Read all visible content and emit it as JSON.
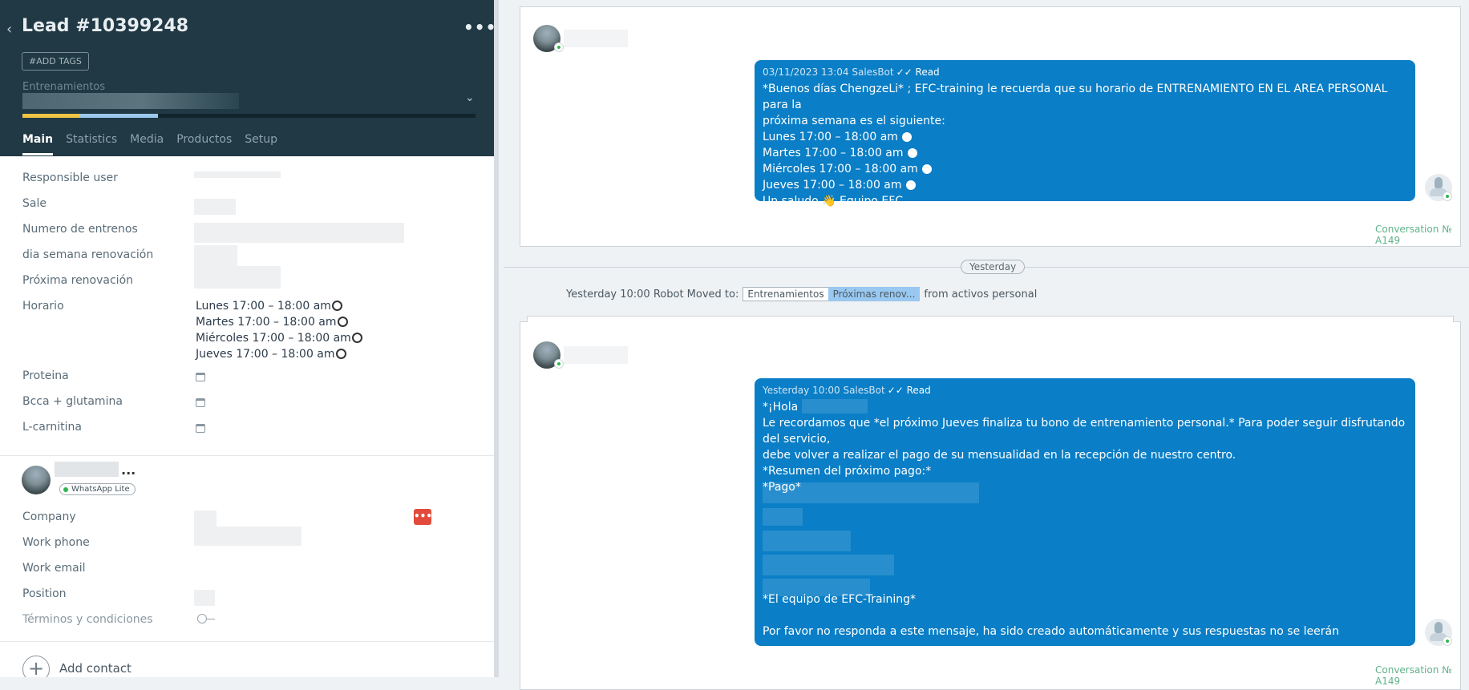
{
  "lead": {
    "title": "Lead #10399248",
    "more": "•••",
    "back": "‹",
    "add_tags": "#ADD TAGS",
    "pipeline_label": "Entrenamientos",
    "tabs": [
      "Main",
      "Statistics",
      "Media",
      "Productos",
      "Setup"
    ]
  },
  "fields": {
    "responsible_user": "Responsible user",
    "sale": "Sale",
    "numero_entrenos": "Numero de entrenos",
    "dia_semana": "dia semana renovación",
    "proxima_renovacion": "Próxima renovación",
    "horario": "Horario",
    "horario_lines": [
      "Lunes 17:00 – 18:00 am",
      "Martes 17:00 – 18:00 am",
      "Miércoles 17:00 – 18:00 am",
      "Jueves 17:00 – 18:00 am"
    ],
    "proteina": "Proteina",
    "bcca": "Bcca + glutamina",
    "lcarnitina": "L-carnitina"
  },
  "contact": {
    "more": "...",
    "badge": "WhatsApp Lite",
    "company": "Company",
    "company_btn": "•••",
    "work_phone": "Work phone",
    "work_email": "Work email",
    "position": "Position",
    "terminos": "Términos y condiciones",
    "add_contact": "Add contact"
  },
  "feed": {
    "msg1": {
      "meta": "03/11/2023 13:04 SalesBot",
      "read": "✓✓ Read",
      "lines": [
        "*Buenos días ChengzeLi* ; EFC-training le recuerda que su horario de ENTRENAMIENTO EN EL AREA PERSONAL para la",
        "próxima semana es el siguiente:",
        "Lunes 17:00 – 18:00 am",
        "Martes 17:00 – 18:00 am",
        "Miércoles 17:00 – 18:00 am",
        "Jueves 17:00 – 18:00 am",
        "Un saludo 👋 Equipo EFC"
      ]
    },
    "conv1": "Conversation № A149",
    "date_separator": "Yesterday",
    "robot": {
      "prefix": "Yesterday 10:00 Robot Moved to:",
      "stage_from": "Entrenamientos",
      "stage_to": "Próximas renov...",
      "suffix": "from activos personal"
    },
    "msg2": {
      "meta": "Yesterday 10:00 SalesBot",
      "read": "✓✓ Read",
      "lines": [
        "*¡Hola",
        "Le recordamos que *el próximo Jueves finaliza tu bono de entrenamiento personal.* Para poder seguir disfrutando del servicio,",
        "debe volver a realizar el pago de su mensualidad en la recepción de nuestro centro.",
        "*Resumen del próximo pago:*",
        "*Pago*"
      ],
      "footer_lines": [
        "*El equipo de EFC-Training*",
        "",
        "Por favor no responda a este mensaje, ha sido creado automáticamente y sus respuestas no se leerán"
      ]
    },
    "conv2": "Conversation № A149"
  },
  "colors": {
    "header_bg": "#203944",
    "bubble": "#0a7ec6",
    "accent_yellow": "#f0c344",
    "accent_blue": "#9ac8ed"
  }
}
